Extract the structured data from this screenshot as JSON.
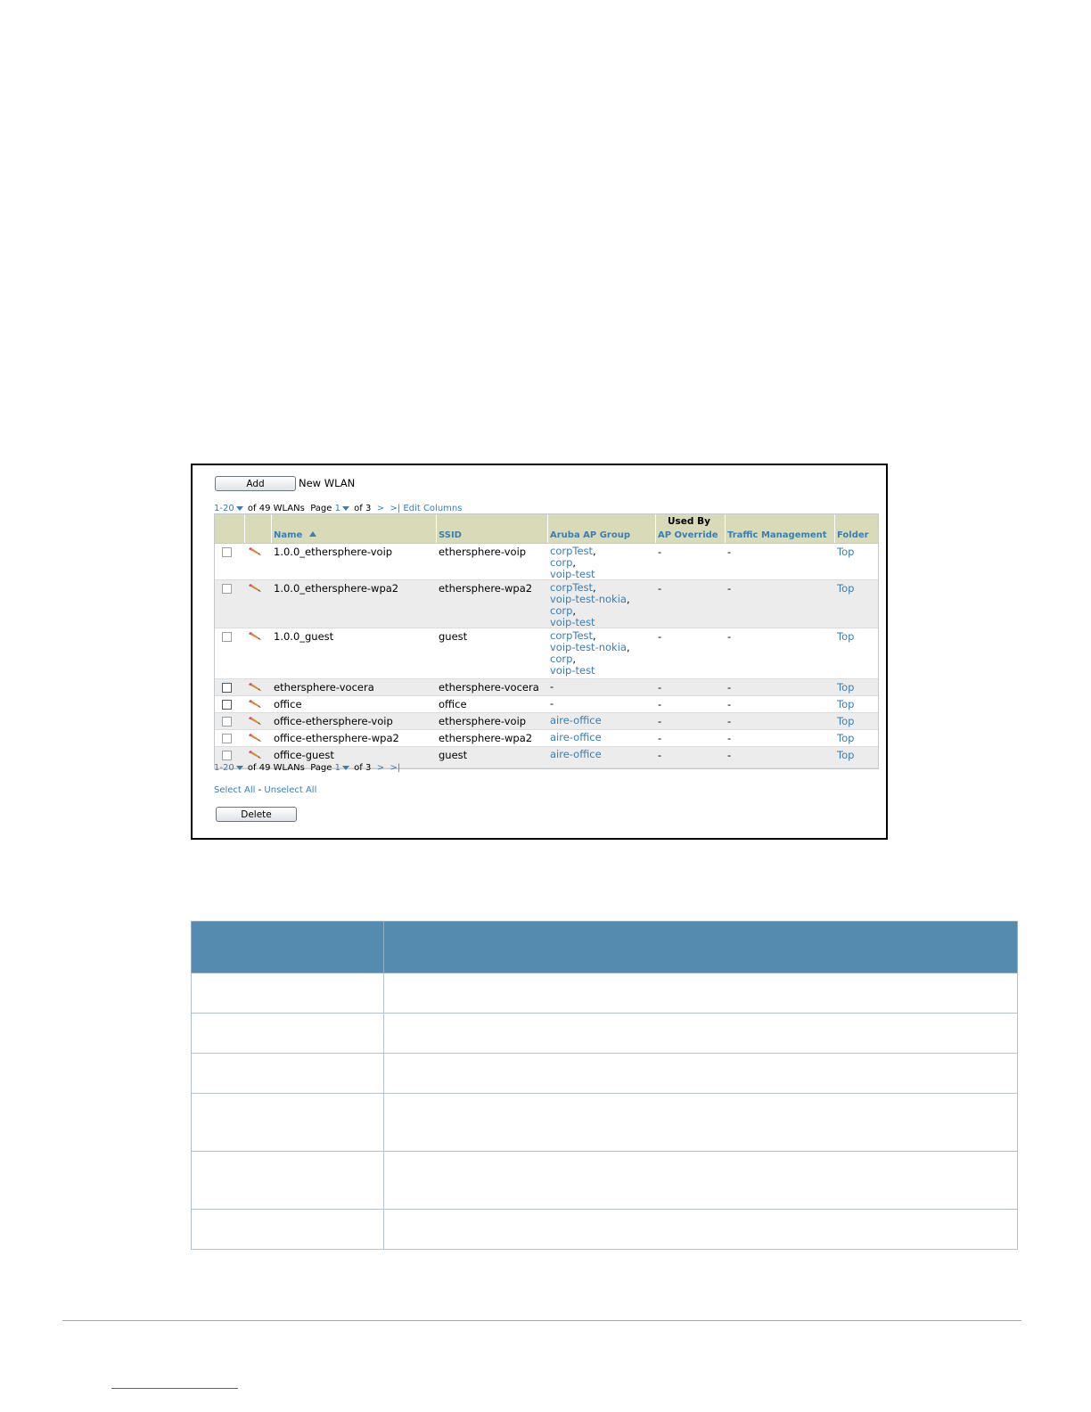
{
  "toolbar": {
    "add_label": "Add",
    "add_suffix": "New WLAN",
    "delete_label": "Delete"
  },
  "pager_top": {
    "range": "1-20",
    "of": "of 49 WLANs",
    "page_label": "Page",
    "page": "1",
    "of_pages": "of 3",
    "next": ">",
    "last": ">|",
    "edit_columns": "Edit Columns"
  },
  "pager_bottom": {
    "range": "1-20",
    "of": "of 49 WLANs",
    "page_label": "Page",
    "page": "1",
    "of_pages": "of 3",
    "next": ">",
    "last": ">|"
  },
  "selection": {
    "select_all": "Select All",
    "separator": " - ",
    "unselect_all": "Unselect All"
  },
  "grid": {
    "group_header": "Used By",
    "columns": {
      "name": "Name",
      "ssid": "SSID",
      "group": "Aruba AP Group",
      "override": "AP Override",
      "traffic": "Traffic Management",
      "folder": "Folder"
    },
    "rows": [
      {
        "name": "1.0.0_ethersphere-voip",
        "ssid": "ethersphere-voip",
        "groups": [
          "corpTest,",
          "corp,",
          "voip-test"
        ],
        "override": "-",
        "traffic": "-",
        "folder": "Top"
      },
      {
        "name": "1.0.0_ethersphere-wpa2",
        "ssid": "ethersphere-wpa2",
        "groups": [
          "corpTest,",
          "voip-test-nokia,",
          "corp,",
          "voip-test"
        ],
        "override": "-",
        "traffic": "-",
        "folder": "Top"
      },
      {
        "name": "1.0.0_guest",
        "ssid": "guest",
        "groups": [
          "corpTest,",
          "voip-test-nokia,",
          "corp,",
          "voip-test"
        ],
        "override": "-",
        "traffic": "-",
        "folder": "Top"
      },
      {
        "name": "ethersphere-vocera",
        "ssid": "ethersphere-vocera",
        "groups": [
          "-"
        ],
        "override": "-",
        "traffic": "-",
        "folder": "Top"
      },
      {
        "name": "office",
        "ssid": "office",
        "groups": [
          "-"
        ],
        "override": "-",
        "traffic": "-",
        "folder": "Top"
      },
      {
        "name": "office-ethersphere-voip",
        "ssid": "ethersphere-voip",
        "groups": [
          "aire-office"
        ],
        "override": "-",
        "traffic": "-",
        "folder": "Top"
      },
      {
        "name": "office-ethersphere-wpa2",
        "ssid": "ethersphere-wpa2",
        "groups": [
          "aire-office"
        ],
        "override": "-",
        "traffic": "-",
        "folder": "Top"
      },
      {
        "name": "office-guest",
        "ssid": "guest",
        "groups": [
          "aire-office"
        ],
        "override": "-",
        "traffic": "-",
        "folder": "Top"
      }
    ]
  },
  "colors": {
    "link": "#3a7eb3",
    "grid_header": "#d9dbb8",
    "table_header": "#558bae"
  }
}
